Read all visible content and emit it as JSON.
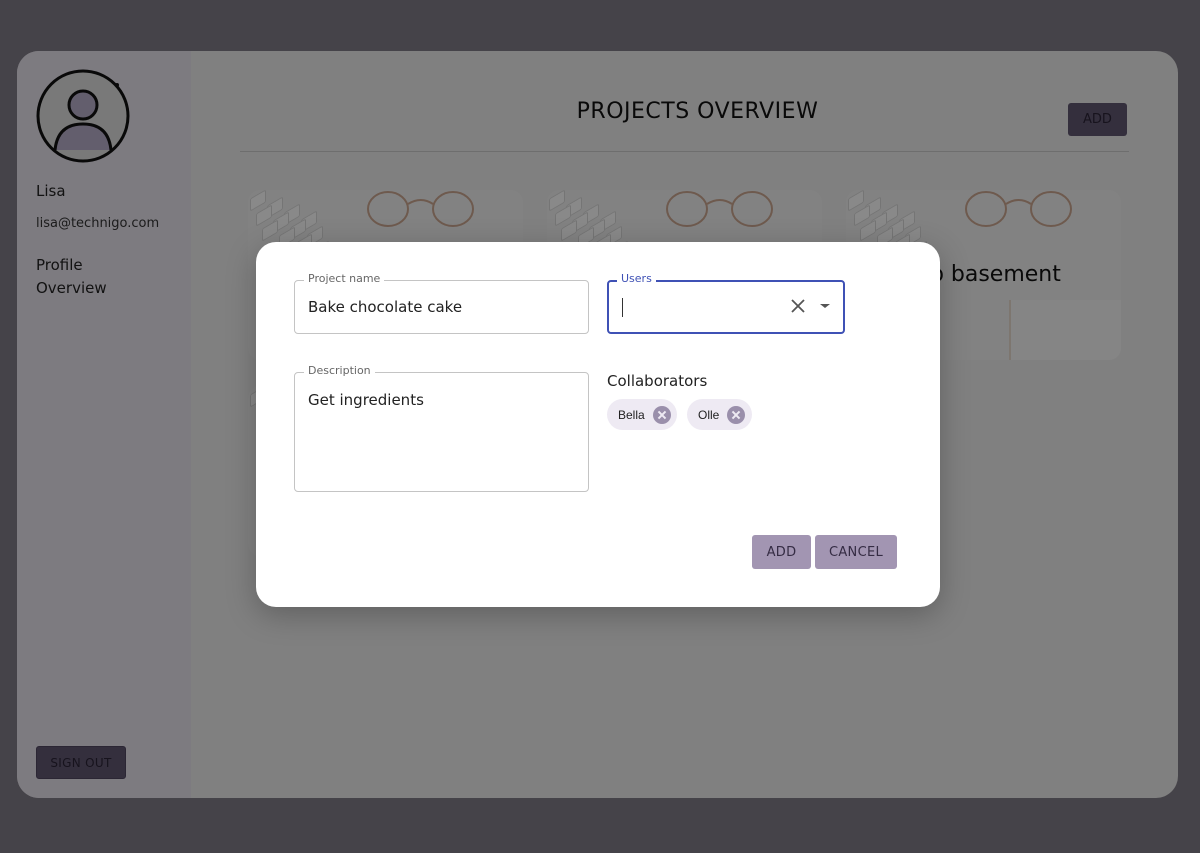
{
  "sidebar": {
    "user_name": "Lisa",
    "user_email": "lisa@technigo.com",
    "nav": [
      "Profile",
      "Overview"
    ],
    "sign_out": "SIGN OUT"
  },
  "main": {
    "title": "PROJECTS OVERVIEW",
    "add_label": "ADD",
    "cards": [
      {
        "title": ""
      },
      {
        "title": ""
      },
      {
        "title": "up basement"
      },
      {
        "title": ""
      }
    ]
  },
  "dialog": {
    "project_name": {
      "label": "Project name",
      "value": "Bake chocolate cake"
    },
    "users": {
      "label": "Users",
      "value": ""
    },
    "description": {
      "label": "Description",
      "value": "Get ingredients"
    },
    "collaborators_title": "Collaborators",
    "collaborators": [
      "Bella",
      "Olle"
    ],
    "add_label": "ADD",
    "cancel_label": "CANCEL"
  },
  "colors": {
    "accent": "#3f51b5",
    "button": "#a295b2",
    "sidebar": "#e4e0ea"
  },
  "icons": [
    "avatar-icon",
    "clear-icon",
    "dropdown-arrow-icon",
    "chip-remove-icon"
  ]
}
